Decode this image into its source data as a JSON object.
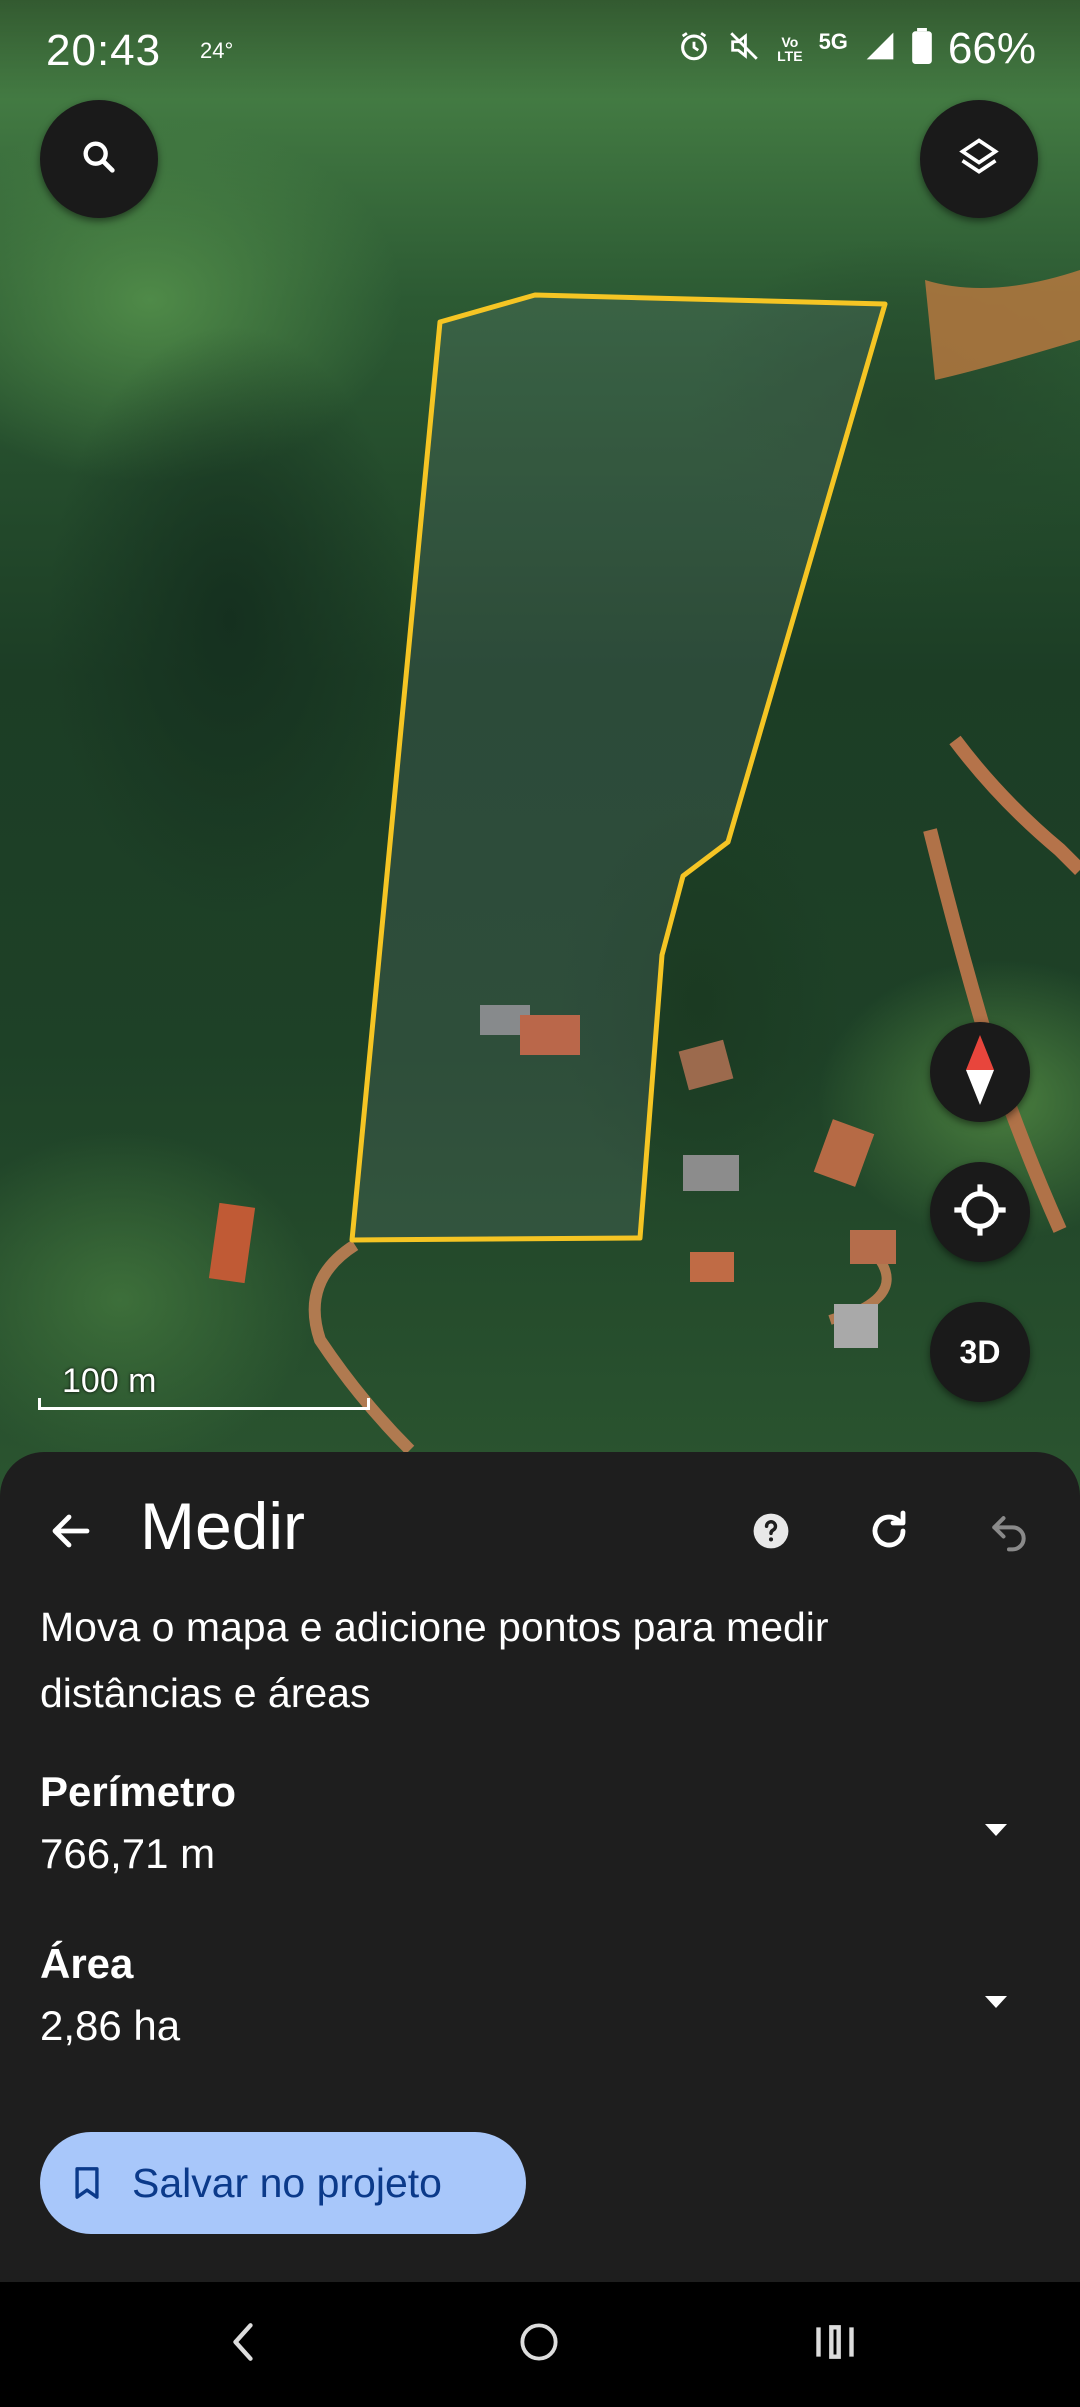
{
  "status_bar": {
    "time": "20:43",
    "temperature": "24°",
    "network": "5G",
    "volte": "Vo\nLTE",
    "battery": "66%",
    "icons": [
      "alarm-icon",
      "mute-icon",
      "volte-icon",
      "signal-icon",
      "battery-icon"
    ]
  },
  "map": {
    "scale_label": "100 m",
    "layers_icon": "layers-icon",
    "search_icon": "search-icon",
    "compass_icon": "compass-icon",
    "location_icon": "my-location-icon",
    "btn_3d": "3D",
    "polygon_color": "#f5c524"
  },
  "measure_panel": {
    "title": "Medir",
    "instructions": "Mova o mapa e adicione pontos para medir distâncias e áreas",
    "perimeter_label": "Perímetro",
    "perimeter_value": "766,71 m",
    "area_label": "Área",
    "area_value": "2,86 ha",
    "save_button": "Salvar no projeto",
    "save_button_color": "#a8c7fa",
    "icons": {
      "back": "arrow-back-icon",
      "help": "help-icon",
      "refresh": "refresh-icon",
      "undo": "undo-icon",
      "bookmark": "bookmark-icon"
    }
  },
  "nav_bar": {
    "icons": [
      "nav-back-icon",
      "nav-home-icon",
      "nav-recents-icon"
    ]
  }
}
